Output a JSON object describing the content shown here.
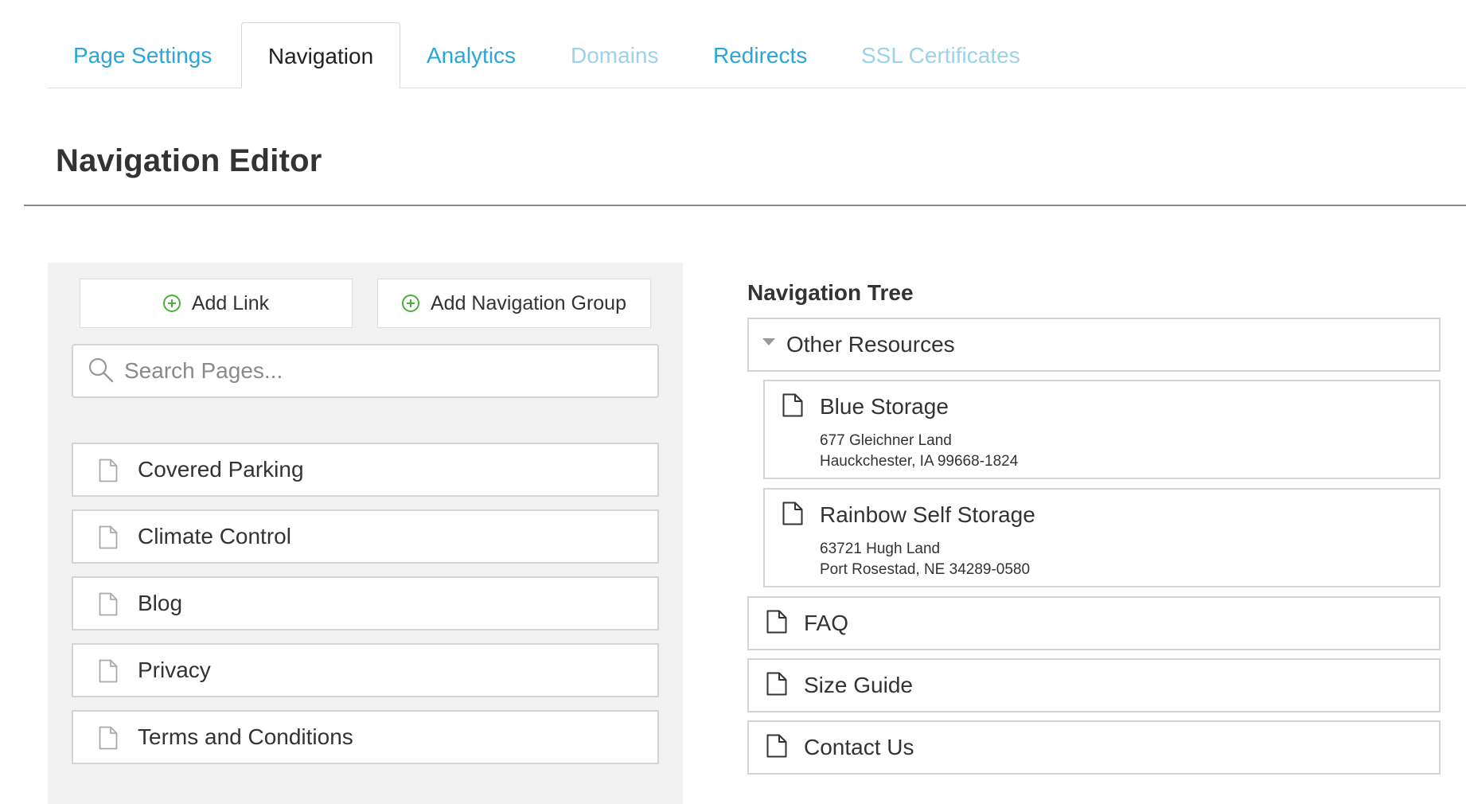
{
  "tabs": [
    {
      "label": "Page Settings",
      "state": "normal"
    },
    {
      "label": "Navigation",
      "state": "active"
    },
    {
      "label": "Analytics",
      "state": "normal"
    },
    {
      "label": "Domains",
      "state": "disabled"
    },
    {
      "label": "Redirects",
      "state": "normal"
    },
    {
      "label": "SSL Certificates",
      "state": "disabled"
    }
  ],
  "header": {
    "title": "Navigation Editor"
  },
  "left_panel": {
    "add_link_label": "Add Link",
    "add_group_label": "Add Navigation Group",
    "search": {
      "placeholder": "Search Pages...",
      "value": ""
    },
    "pages": [
      {
        "label": "Covered Parking",
        "icon": "document-icon"
      },
      {
        "label": "Climate Control",
        "icon": "document-icon"
      },
      {
        "label": "Blog",
        "icon": "document-icon"
      },
      {
        "label": "Privacy",
        "icon": "document-icon"
      },
      {
        "label": "Terms and Conditions",
        "icon": "document-icon"
      }
    ]
  },
  "tree": {
    "heading": "Navigation Tree",
    "group": {
      "label": "Other Resources",
      "expanded": true,
      "children": [
        {
          "title": "Blue Storage",
          "address_line1": "677 Gleichner Land",
          "address_line2": "Hauckchester, IA 99668-1824"
        },
        {
          "title": "Rainbow Self Storage",
          "address_line1": "63721 Hugh Land",
          "address_line2": "Port Rosestad, NE 34289-0580"
        }
      ]
    },
    "items": [
      {
        "label": "FAQ"
      },
      {
        "label": "Size Guide"
      },
      {
        "label": "Contact Us"
      }
    ]
  },
  "colors": {
    "tab_link": "#2aa6d8",
    "tab_disabled": "#9cd3ea",
    "add_icon": "#4caf3c",
    "panel_bg": "#f2f2f2",
    "border": "#d4d4d4"
  }
}
